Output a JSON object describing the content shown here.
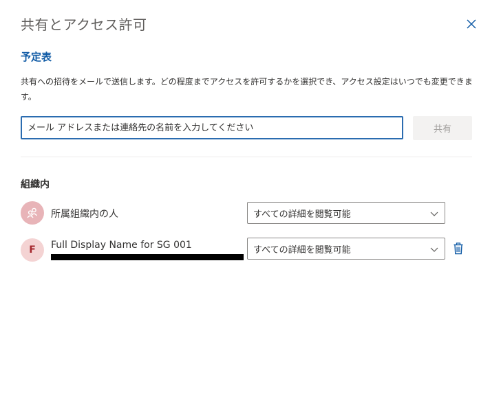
{
  "dialog": {
    "title": "共有とアクセス許可",
    "close_icon": "close-icon"
  },
  "calendar": {
    "name": "予定表",
    "description": "共有への招待をメールで送信します。どの程度までアクセスを許可するかを選択でき、アクセス設定はいつでも変更できます。"
  },
  "invite": {
    "placeholder": "メール アドレスまたは連絡先の名前を入力してください",
    "value": "",
    "share_label": "共有"
  },
  "organization": {
    "heading": "組織内",
    "entries": [
      {
        "name": "所属組織内の人",
        "avatar_icon": "people-group-icon",
        "permission": "すべての詳細を閲覧可能"
      },
      {
        "name": "Full Display Name for SG 001",
        "avatar_initial": "F",
        "permission": "すべての詳細を閲覧可能",
        "delete_icon": "trash-icon"
      }
    ]
  },
  "colors": {
    "accent": "#0f5aa5",
    "input_border": "#2b6cb0",
    "avatar_group": "#e8b4b8",
    "avatar_person": "#f4d3d3"
  }
}
